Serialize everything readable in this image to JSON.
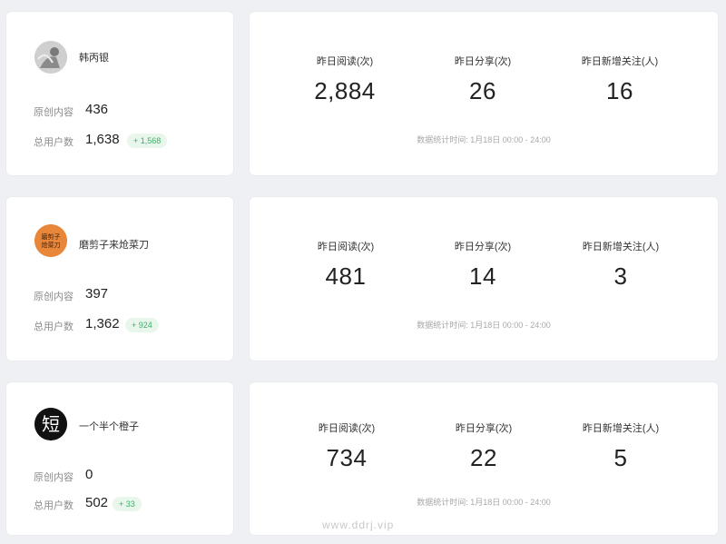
{
  "accounts": [
    {
      "name": "韩丙银",
      "avatar_icon": "person-photo-icon",
      "original_label": "原创内容",
      "original_value": "436",
      "users_label": "总用户数",
      "users_value": "1,638",
      "users_delta": "+ 1,568",
      "metrics": [
        {
          "label": "昨日阅读(次)",
          "value": "2,884"
        },
        {
          "label": "昨日分享(次)",
          "value": "26"
        },
        {
          "label": "昨日新增关注(人)",
          "value": "16"
        }
      ],
      "note": "数据统计时间: 1月18日 00:00 - 24:00"
    },
    {
      "name": "磨剪子来炝菜刀",
      "avatar_text": "磨剪子\n炝菜刀",
      "avatar_color": "#e8863a",
      "original_label": "原创内容",
      "original_value": "397",
      "users_label": "总用户数",
      "users_value": "1,362",
      "users_delta": "+ 924",
      "metrics": [
        {
          "label": "昨日阅读(次)",
          "value": "481"
        },
        {
          "label": "昨日分享(次)",
          "value": "14"
        },
        {
          "label": "昨日新增关注(人)",
          "value": "3"
        }
      ],
      "note": "数据统计时间: 1月18日 00:00 - 24:00"
    },
    {
      "name": "一个半个橙子",
      "avatar_text": "短",
      "avatar_color": "#111111",
      "original_label": "原创内容",
      "original_value": "0",
      "users_label": "总用户数",
      "users_value": "502",
      "users_delta": "+ 33",
      "metrics": [
        {
          "label": "昨日阅读(次)",
          "value": "734"
        },
        {
          "label": "昨日分享(次)",
          "value": "22"
        },
        {
          "label": "昨日新增关注(人)",
          "value": "5"
        }
      ],
      "note": "数据统计时间: 1月18日 00:00 - 24:00"
    }
  ],
  "watermark": "www.ddrj.vip",
  "colors": {
    "background": "#eef0f3",
    "card": "#ffffff",
    "badge_bg": "#e8f6ec",
    "badge_text": "#3cb067"
  }
}
